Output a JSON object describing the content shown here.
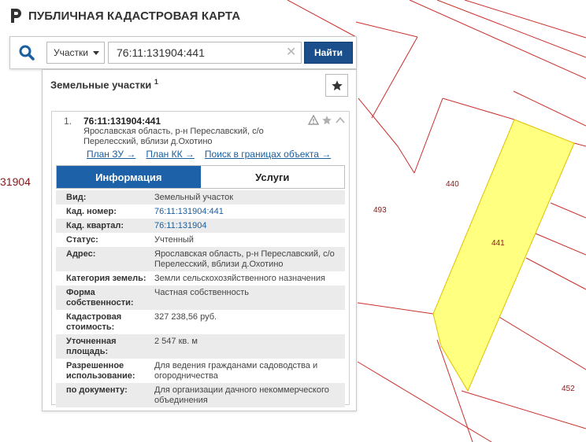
{
  "app": {
    "title": "ПУБЛИЧНАЯ КАДАСТРОВАЯ КАРТА"
  },
  "search": {
    "type_label": "Участки",
    "query": "76:11:131904:441",
    "button_label": "Найти"
  },
  "panel": {
    "title": "Земельные участки",
    "count": "1"
  },
  "result": {
    "number": "1.",
    "cad_number": "76:11:131904:441",
    "address_line1": "Ярославская область, р-н Переславский, с/о",
    "address_line2": "Перелесский, вблизи д.Охотино",
    "links": [
      "План ЗУ →",
      "План КК →",
      "Поиск в границах объекта →"
    ]
  },
  "tabs": [
    {
      "label": "Информация",
      "active": true
    },
    {
      "label": "Услуги",
      "active": false
    }
  ],
  "info": [
    {
      "label": "Вид:",
      "value": "Земельный участок"
    },
    {
      "label": "Кад. номер:",
      "value": "76:11:131904:441",
      "link": true
    },
    {
      "label": "Кад. квартал:",
      "value": "76:11:131904",
      "link": true
    },
    {
      "label": "Статус:",
      "value": "Учтенный"
    },
    {
      "label": "Адрес:",
      "value": "Ярославская область, р-н Переславский, с/о Перелесский, вблизи д.Охотино"
    },
    {
      "label": "Категория земель:",
      "value": "Земли сельскохозяйственного назначения"
    },
    {
      "label": "Форма собственности:",
      "value": "Частная собственность"
    },
    {
      "label": "Кадастровая стоимость:",
      "value": "327 238,56 руб."
    },
    {
      "label": "Уточненная площадь:",
      "value": "2 547 кв. м"
    },
    {
      "label": "Разрешенное использование:",
      "value": "Для ведения гражданами садоводства и огородничества"
    },
    {
      "label": "по документу:",
      "value": "Для организации дачного некоммерческого объединения"
    }
  ],
  "map": {
    "parcel_labels": [
      "440",
      "441",
      "493",
      "452"
    ],
    "quarter_label": "31904",
    "colors": {
      "boundary": "#c9302c",
      "selected_fill": "#ffff80",
      "selected_stroke": "#e0c000",
      "label": "#8b1a1a"
    }
  }
}
